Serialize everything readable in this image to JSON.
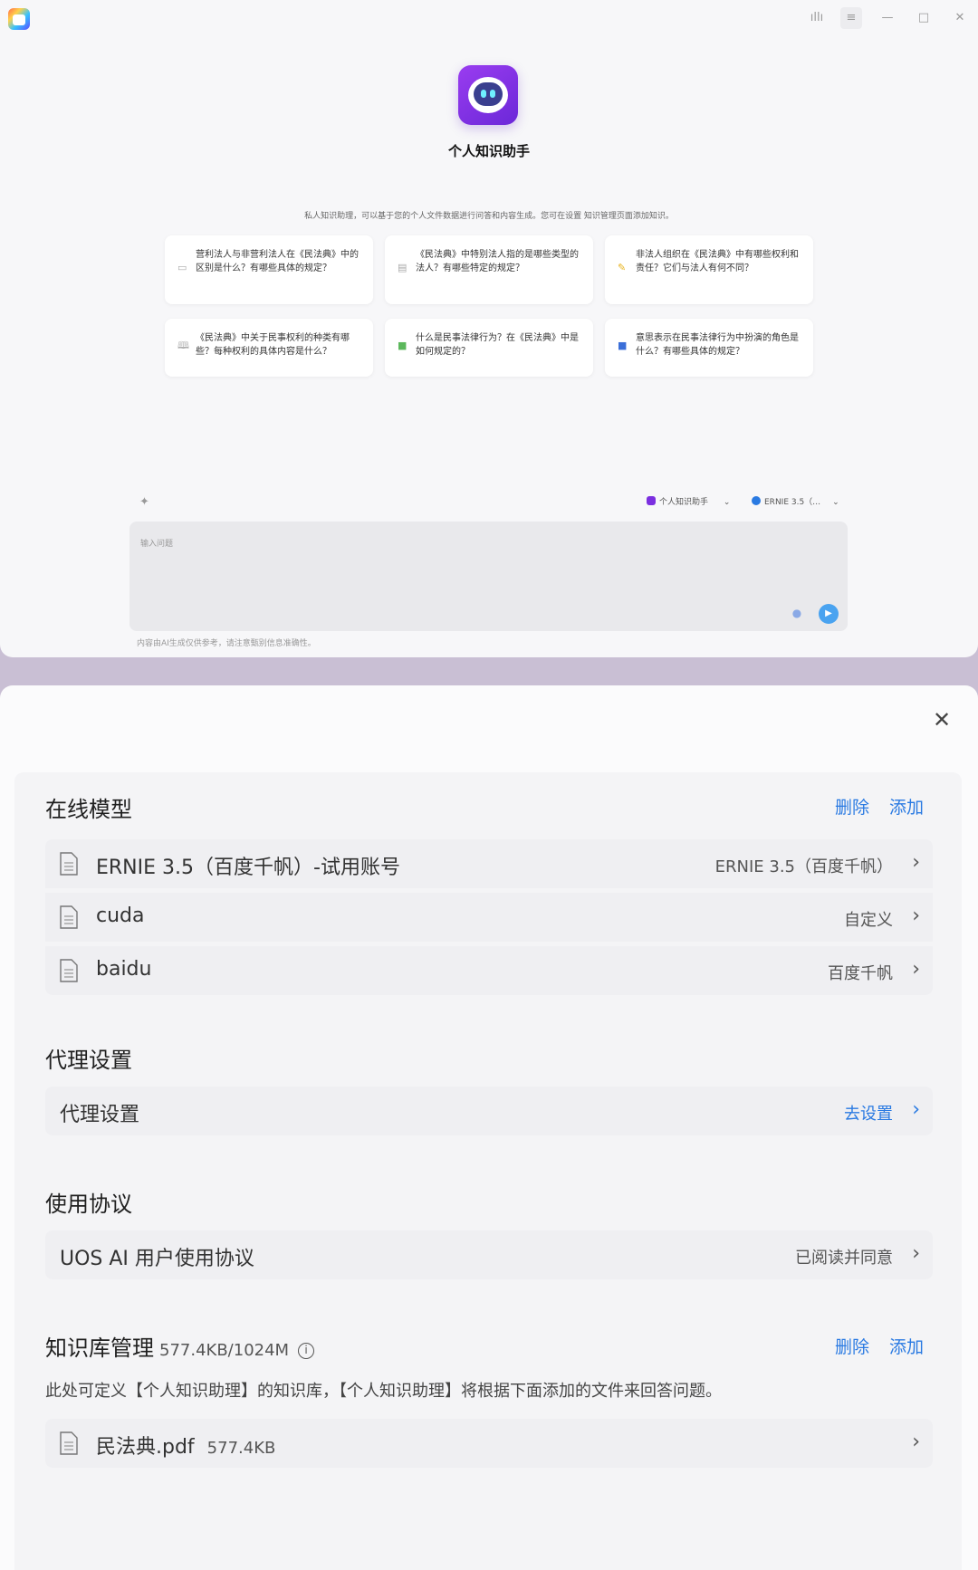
{
  "top_window": {
    "titlebar": {
      "icons": [
        "app-logo-icon",
        "voice-icon",
        "menu-icon",
        "minimize-icon",
        "maximize-icon",
        "close-icon"
      ],
      "voice_glyph": "ıllı",
      "menu_glyph": "≡",
      "min_glyph": "—",
      "max_glyph": "□",
      "close_glyph": "✕"
    },
    "assistant_name": "个人知识助手",
    "description": "私人知识助理，可以基于您的个人文件数据进行问答和内容生成。您可在设置 知识管理页面添加知识。",
    "suggestions": [
      {
        "icon": "document-icon",
        "glyph": "▭",
        "text": "营利法人与非营利法人在《民法典》中的区别是什么？有哪些具体的规定？"
      },
      {
        "icon": "clipboard-icon",
        "glyph": "▤",
        "text": "《民法典》中特别法人指的是哪些类型的法人？有哪些特定的规定？"
      },
      {
        "icon": "pencil-icon",
        "glyph": "✎",
        "text": "非法人组织在《民法典》中有哪些权利和责任？它们与法人有何不同？"
      },
      {
        "icon": "book-icon",
        "glyph": "🕮",
        "text": "《民法典》中关于民事权利的种类有哪些？每种权利的具体内容是什么？"
      },
      {
        "icon": "green-book-icon",
        "glyph": "■",
        "text": "什么是民事法律行为？在《民法典》中是如何规定的？"
      },
      {
        "icon": "blue-book-icon",
        "glyph": "■",
        "text": "意思表示在民事法律行为中扮演的角色是什么？有哪些具体的规定？"
      }
    ],
    "assistant_selector": "个人知识助手",
    "model_selector": "ERNIE 3.5（…",
    "input_placeholder": "输入问题",
    "disclaimer": "内容由AI生成仅供参考，请注意甄别信息准确性。"
  },
  "settings": {
    "online_models": {
      "title": "在线模型",
      "delete_label": "删除",
      "add_label": "添加",
      "items": [
        {
          "name": "ERNIE 3.5（百度千帆）-试用账号",
          "value": "ERNIE 3.5（百度千帆）"
        },
        {
          "name": "cuda",
          "value": "自定义"
        },
        {
          "name": "baidu",
          "value": "百度千帆"
        }
      ]
    },
    "proxy": {
      "title": "代理设置",
      "row_label": "代理设置",
      "row_action": "去设置"
    },
    "agreement": {
      "title": "使用协议",
      "row_label": "UOS AI 用户使用协议",
      "row_value": "已阅读并同意"
    },
    "knowledge_base": {
      "title": "知识库管理",
      "usage": "577.4KB/1024M",
      "delete_label": "删除",
      "add_label": "添加",
      "description": "此处可定义【个人知识助理】的知识库，【个人知识助理】将根据下面添加的文件来回答问题。",
      "files": [
        {
          "name": "民法典.pdf",
          "size": "577.4KB"
        }
      ]
    },
    "chevron": "›",
    "close_glyph": "✕",
    "info_glyph": "i"
  },
  "colors": {
    "accent": "#2a7ae2",
    "logo_purple": "#7b2fe0",
    "send_blue": "#4aa3f0"
  }
}
